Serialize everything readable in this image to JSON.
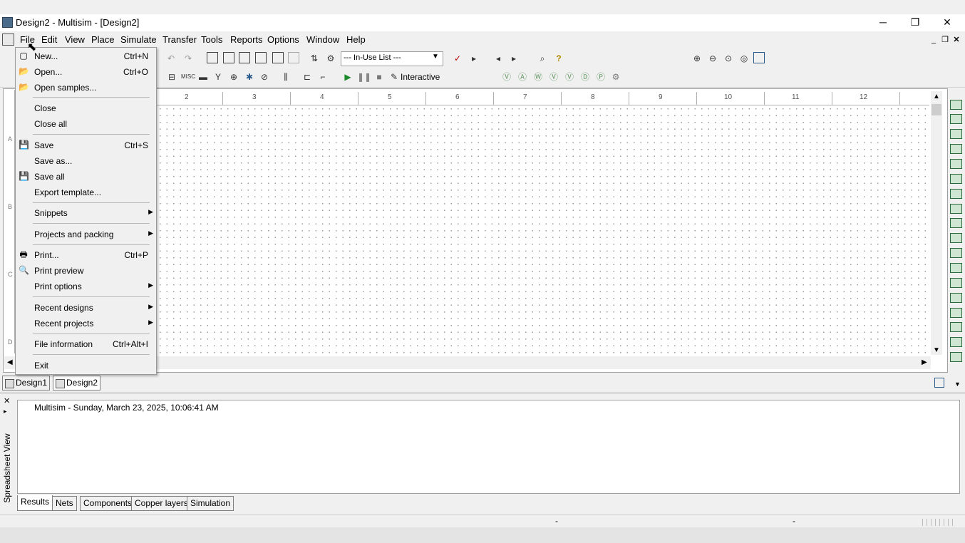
{
  "window": {
    "title": "Design2 - Multisim - [Design2]",
    "minimize": "─",
    "restore": "❐",
    "close": "✕"
  },
  "menubar": {
    "items": [
      "File",
      "Edit",
      "View",
      "Place",
      "Simulate",
      "Transfer",
      "Tools",
      "Reports",
      "Options",
      "Window",
      "Help"
    ]
  },
  "toolbar": {
    "inuse_list": "--- In-Use List ---",
    "interactive": "Interactive"
  },
  "ruler": {
    "top": [
      "2",
      "3",
      "4",
      "5",
      "6",
      "7",
      "8",
      "9",
      "10",
      "11",
      "12"
    ],
    "left": [
      "A",
      "B",
      "C",
      "D"
    ]
  },
  "doc_tabs": [
    "Design1",
    "Design2"
  ],
  "file_menu": {
    "items": [
      {
        "label": "New...",
        "shortcut": "Ctrl+N",
        "icon": "new-icon"
      },
      {
        "label": "Open...",
        "shortcut": "Ctrl+O",
        "icon": "open-folder-icon"
      },
      {
        "label": "Open samples...",
        "shortcut": "",
        "icon": "open-samples-icon"
      },
      {
        "label": "Close",
        "shortcut": ""
      },
      {
        "label": "Close all",
        "shortcut": ""
      },
      {
        "label": "Save",
        "shortcut": "Ctrl+S",
        "icon": "save-icon"
      },
      {
        "label": "Save as...",
        "shortcut": ""
      },
      {
        "label": "Save all",
        "shortcut": "",
        "icon": "save-all-icon"
      },
      {
        "label": "Export template...",
        "shortcut": ""
      },
      {
        "label": "Snippets",
        "shortcut": "",
        "submenu": true
      },
      {
        "label": "Projects and packing",
        "shortcut": "",
        "submenu": true
      },
      {
        "label": "Print...",
        "shortcut": "Ctrl+P",
        "icon": "printer-icon"
      },
      {
        "label": "Print preview",
        "shortcut": "",
        "icon": "print-preview-icon"
      },
      {
        "label": "Print options",
        "shortcut": "",
        "submenu": true
      },
      {
        "label": "Recent designs",
        "shortcut": "",
        "submenu": true
      },
      {
        "label": "Recent projects",
        "shortcut": "",
        "submenu": true
      },
      {
        "label": "File information",
        "shortcut": "Ctrl+Alt+I"
      },
      {
        "label": "Exit",
        "shortcut": ""
      }
    ]
  },
  "spreadsheet": {
    "side_label": "Spreadsheet View",
    "log": "Multisim  -  Sunday, March 23, 2025, 10:06:41 AM",
    "tabs": [
      "Results",
      "Nets",
      "Components",
      "Copper layers",
      "Simulation"
    ]
  },
  "status": {
    "left_dash": "-",
    "right_dash": "-"
  }
}
